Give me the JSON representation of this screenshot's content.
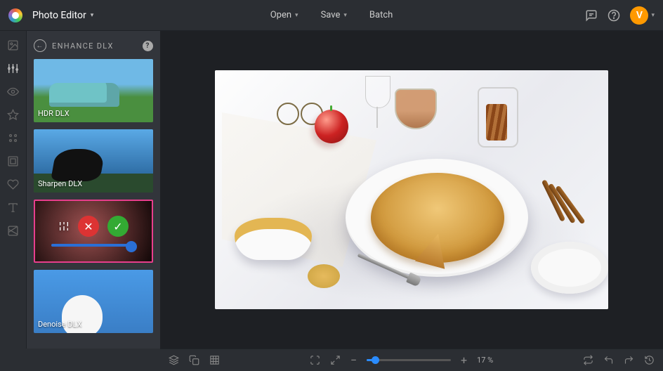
{
  "header": {
    "app_name": "Photo Editor",
    "open_label": "Open",
    "save_label": "Save",
    "batch_label": "Batch",
    "avatar_initial": "V"
  },
  "panel": {
    "title": "ENHANCE DLX",
    "effects": [
      {
        "label": "HDR DLX"
      },
      {
        "label": "Sharpen DLX"
      },
      {
        "label": ""
      },
      {
        "label": "Denoise DLX"
      }
    ]
  },
  "footer": {
    "zoom": "17 %"
  }
}
